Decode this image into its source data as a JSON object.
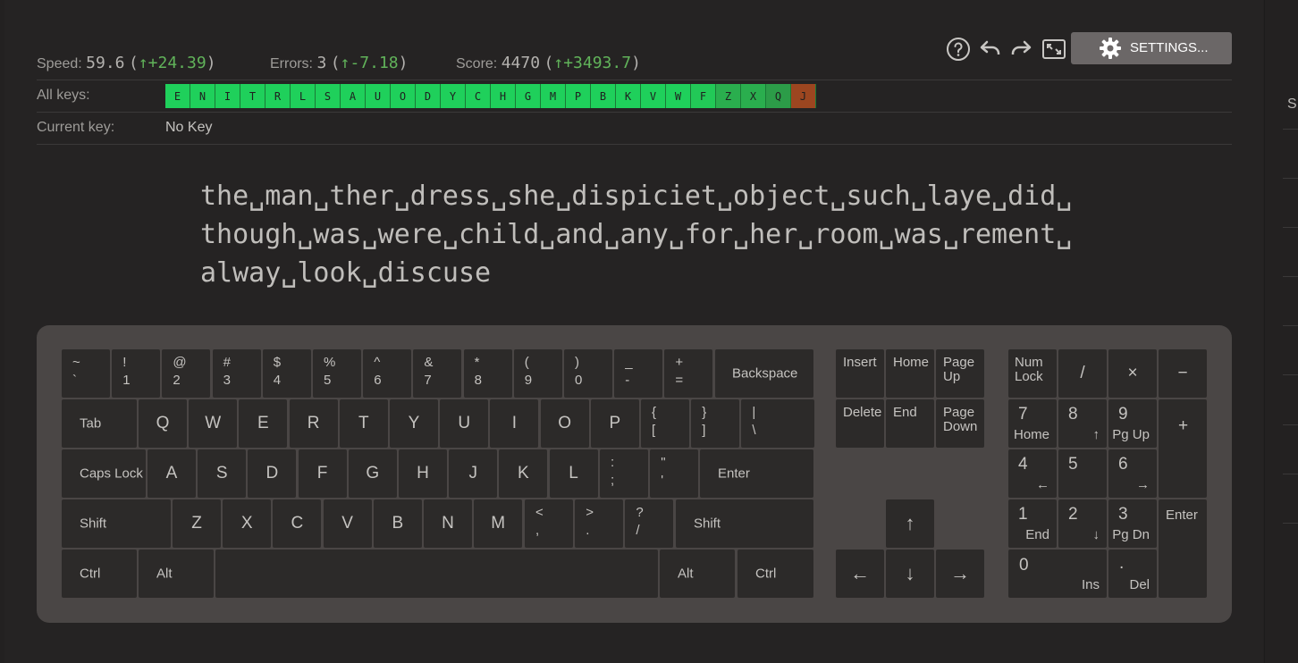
{
  "stats": {
    "speed_label": "Speed:",
    "speed_value": "59.6",
    "speed_delta": "+24.39",
    "errors_label": "Errors:",
    "errors_value": "3",
    "errors_delta": "-7.18",
    "score_label": "Score:",
    "score_value": "4470",
    "score_delta": "+3493.7",
    "open_paren": "(",
    "close_paren": ")",
    "up_arrow": "↑"
  },
  "toolbar": {
    "help_icon": "help-icon",
    "undo_icon": "undo-icon",
    "redo_icon": "redo-icon",
    "fullscreen_icon": "fullscreen-icon",
    "settings_label": "SETTINGS..."
  },
  "all_keys": {
    "label": "All keys:",
    "keys": [
      {
        "k": "E",
        "color": "#1fd05b"
      },
      {
        "k": "N",
        "color": "#1fd05b"
      },
      {
        "k": "I",
        "color": "#1fd05b"
      },
      {
        "k": "T",
        "color": "#1fd05b"
      },
      {
        "k": "R",
        "color": "#1fd05b"
      },
      {
        "k": "L",
        "color": "#1fd05b"
      },
      {
        "k": "S",
        "color": "#1fd05b"
      },
      {
        "k": "A",
        "color": "#1fd05b"
      },
      {
        "k": "U",
        "color": "#1fd05b"
      },
      {
        "k": "O",
        "color": "#1fd05b"
      },
      {
        "k": "D",
        "color": "#1fd05b"
      },
      {
        "k": "Y",
        "color": "#1fd05b"
      },
      {
        "k": "C",
        "color": "#1fd05b"
      },
      {
        "k": "H",
        "color": "#1fd05b"
      },
      {
        "k": "G",
        "color": "#1fd05b"
      },
      {
        "k": "M",
        "color": "#1fd05b"
      },
      {
        "k": "P",
        "color": "#1fd05b"
      },
      {
        "k": "B",
        "color": "#1fd05b"
      },
      {
        "k": "K",
        "color": "#1fd05b"
      },
      {
        "k": "V",
        "color": "#1fd05b"
      },
      {
        "k": "W",
        "color": "#1fd05b"
      },
      {
        "k": "F",
        "color": "#22c957"
      },
      {
        "k": "Z",
        "color": "#2aae4e"
      },
      {
        "k": "X",
        "color": "#2aae4e"
      },
      {
        "k": "Q",
        "color": "#2c9c48"
      },
      {
        "k": "J",
        "color": "#9c4620"
      }
    ]
  },
  "current_key": {
    "label": "Current key:",
    "value": "No Key"
  },
  "practice_text": {
    "lines": [
      "the␣man␣ther␣dress␣she␣dispiciet␣object␣such␣laye␣did␣",
      "though␣was␣were␣child␣and␣any␣for␣her␣room␣was␣rement␣",
      "alway␣look␣discuse"
    ]
  },
  "keyboard": {
    "row1": [
      {
        "t": "~",
        "b": "`"
      },
      {
        "t": "!",
        "b": "1"
      },
      {
        "t": "@",
        "b": "2"
      },
      {
        "t": "#",
        "b": "3"
      },
      {
        "t": "$",
        "b": "4"
      },
      {
        "t": "%",
        "b": "5"
      },
      {
        "t": "^",
        "b": "6"
      },
      {
        "t": "&",
        "b": "7"
      },
      {
        "t": "*",
        "b": "8"
      },
      {
        "t": "(",
        "b": "9"
      },
      {
        "t": ")",
        "b": "0"
      },
      {
        "t": "_",
        "b": "-"
      },
      {
        "t": "+",
        "b": "="
      }
    ],
    "backspace": "Backspace",
    "tab": "Tab",
    "row2": [
      "Q",
      "W",
      "E",
      "R",
      "T",
      "Y",
      "U",
      "I",
      "O",
      "P"
    ],
    "row2_sym": [
      {
        "t": "{",
        "b": "["
      },
      {
        "t": "}",
        "b": "]"
      },
      {
        "t": "|",
        "b": "\\"
      }
    ],
    "caps": "Caps Lock",
    "row3": [
      "A",
      "S",
      "D",
      "F",
      "G",
      "H",
      "J",
      "K",
      "L"
    ],
    "row3_sym": [
      {
        "t": ":",
        "b": ";"
      },
      {
        "t": "\"",
        "b": "'"
      }
    ],
    "enter": "Enter",
    "shift_left": "Shift",
    "row4": [
      "Z",
      "X",
      "C",
      "V",
      "B",
      "N",
      "M"
    ],
    "row4_sym": [
      {
        "t": "<",
        "b": ","
      },
      {
        "t": ">",
        "b": "."
      },
      {
        "t": "?",
        "b": "/"
      }
    ],
    "shift_right": "Shift",
    "ctrl_left": "Ctrl",
    "alt_left": "Alt",
    "alt_right": "Alt",
    "ctrl_right": "Ctrl",
    "nav": {
      "insert": "Insert",
      "home": "Home",
      "page_up": "Page Up",
      "delete": "Delete",
      "end": "End",
      "page_down": "Page Down",
      "up": "↑",
      "left": "←",
      "down": "↓",
      "right": "→"
    },
    "numpad": {
      "numlock": "Num Lock",
      "divide": "/",
      "multiply": "×",
      "minus": "−",
      "n7": "7",
      "n7s": "Home",
      "n8": "8",
      "n8s": "↑",
      "n9": "9",
      "n9s": "Pg Up",
      "plus": "+",
      "n4": "4",
      "n4s": "←",
      "n5": "5",
      "n6": "6",
      "n6s": "→",
      "n1": "1",
      "n1s": "End",
      "n2": "2",
      "n2s": "↓",
      "n3": "3",
      "n3s": "Pg Dn",
      "enter": "Enter",
      "n0": "0",
      "n0s": "Ins",
      "dot": ".",
      "dots": "Del"
    }
  },
  "right_panel": {
    "label": "S"
  }
}
